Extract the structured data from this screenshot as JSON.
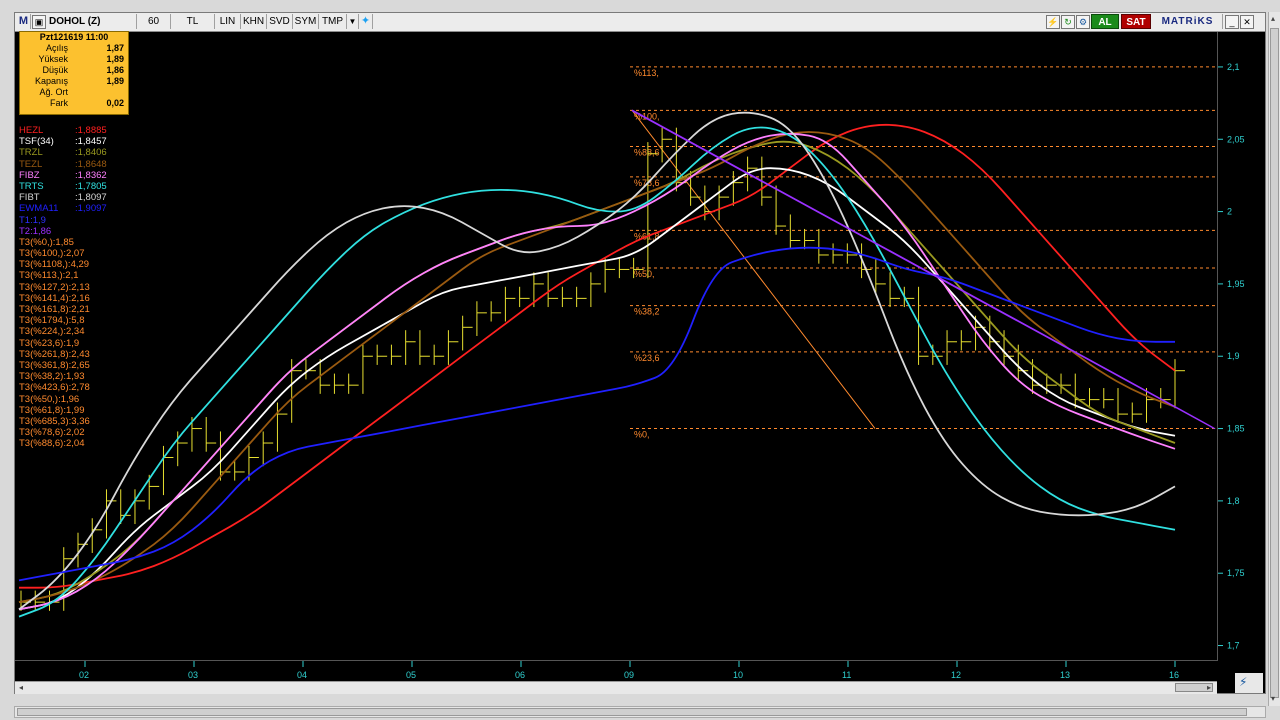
{
  "toolbar": {
    "logo": "M",
    "symbol": "DOHOL (Z)",
    "period": "60",
    "currency": "TL",
    "buttons": [
      "LIN",
      "KHN",
      "SVD",
      "SYM",
      "TMP"
    ],
    "buy_label": "AL",
    "sell_label": "SAT",
    "brand": "MATRiKS"
  },
  "info_box": {
    "title": "Pzt121619 11:00",
    "rows": [
      {
        "label": "Açılış",
        "value": "1,87"
      },
      {
        "label": "Yüksek",
        "value": "1,89"
      },
      {
        "label": "Düşük",
        "value": "1,86"
      },
      {
        "label": "Kapanış",
        "value": "1,89"
      },
      {
        "label": "Ağ. Ort",
        "value": ""
      },
      {
        "label": "Fark",
        "value": "0,02"
      }
    ]
  },
  "legend": [
    {
      "name": "HEZL",
      "value": ":1,8885",
      "color": "#ff2020"
    },
    {
      "name": "TSF(34)",
      "value": ":1,8457",
      "color": "#ffffff"
    },
    {
      "name": "TRZL",
      "value": ":1,8406",
      "color": "#9a9a20"
    },
    {
      "name": "TEZL",
      "value": ":1,8648",
      "color": "#9a5a10"
    },
    {
      "name": "FIBZ",
      "value": ":1,8362",
      "color": "#ff80ff"
    },
    {
      "name": "TRTS",
      "value": ":1,7805",
      "color": "#30e0e0"
    },
    {
      "name": "FIBT",
      "value": ":1,8097",
      "color": "#d8d8d8"
    },
    {
      "name": "EWMA11",
      "value": ":1,9097",
      "color": "#2020ff"
    },
    {
      "name": "T1:1,9",
      "value": "",
      "color": "#3030ff"
    },
    {
      "name": "T2:1,86",
      "value": "",
      "color": "#9a30ff"
    }
  ],
  "t3_levels": [
    "T3(%0,):1,85",
    "T3(%100,):2,07",
    "T3(%1108,):4,29",
    "T3(%113,):2,1",
    "T3(%127,2):2,13",
    "T3(%141,4):2,16",
    "T3(%161,8):2,21",
    "T3(%1794,):5,8",
    "T3(%224,):2,34",
    "T3(%23,6):1,9",
    "T3(%261,8):2,43",
    "T3(%361,8):2,65",
    "T3(%38,2):1,93",
    "T3(%423,6):2,78",
    "T3(%50,):1,96",
    "T3(%61,8):1,99",
    "T3(%685,3):3,36",
    "T3(%78,6):2,02",
    "T3(%88,6):2,04"
  ],
  "chart_data": {
    "type": "line",
    "ylim": [
      1.69,
      2.12
    ],
    "y_ticks": [
      "2,1",
      "2,05",
      "2",
      "1,95",
      "1,9",
      "1,85",
      "1,8",
      "1,75",
      "1,7"
    ],
    "y_values": [
      2.1,
      2.05,
      2.0,
      1.95,
      1.9,
      1.85,
      1.8,
      1.75,
      1.7
    ],
    "x_labels": [
      "02",
      "03",
      "04",
      "05",
      "06",
      "09",
      "10",
      "11",
      "12",
      "13",
      "16"
    ],
    "fib_levels": [
      {
        "label": "%113,",
        "value": 2.1
      },
      {
        "label": "%100,",
        "value": 2.07
      },
      {
        "label": "%88,6",
        "value": 2.045
      },
      {
        "label": "%78,6",
        "value": 2.024
      },
      {
        "label": "%61,8",
        "value": 1.987
      },
      {
        "label": "%50,",
        "value": 1.961
      },
      {
        "label": "%38,2",
        "value": 1.935
      },
      {
        "label": "%23,6",
        "value": 1.903
      },
      {
        "label": "%0,",
        "value": 1.85
      }
    ],
    "fib_color": "#ff8a2e",
    "price_color": "#e8e030",
    "price_close": [
      1.73,
      1.73,
      1.73,
      1.76,
      1.77,
      1.78,
      1.8,
      1.79,
      1.8,
      1.81,
      1.83,
      1.84,
      1.85,
      1.84,
      1.82,
      1.82,
      1.83,
      1.84,
      1.86,
      1.89,
      1.89,
      1.88,
      1.88,
      1.88,
      1.9,
      1.9,
      1.9,
      1.91,
      1.9,
      1.9,
      1.91,
      1.92,
      1.93,
      1.93,
      1.94,
      1.94,
      1.95,
      1.94,
      1.94,
      1.94,
      1.95,
      1.96,
      1.96,
      1.96,
      2.04,
      2.05,
      2.02,
      2.01,
      2.0,
      2.01,
      2.02,
      2.03,
      2.01,
      1.99,
      1.98,
      1.98,
      1.97,
      1.97,
      1.97,
      1.96,
      1.95,
      1.94,
      1.94,
      1.9,
      1.9,
      1.91,
      1.91,
      1.92,
      1.91,
      1.9,
      1.89,
      1.88,
      1.88,
      1.88,
      1.87,
      1.87,
      1.87,
      1.86,
      1.86,
      1.87,
      1.87,
      1.89
    ],
    "series": [
      {
        "name": "HEZL",
        "color": "#ff2020",
        "values": [
          1.74,
          1.74,
          1.745,
          1.75,
          1.76,
          1.775,
          1.79,
          1.81,
          1.83,
          1.85,
          1.87,
          1.89,
          1.91,
          1.93,
          1.95,
          1.965,
          1.98,
          1.99,
          2.0,
          2.01,
          2.03,
          2.05,
          2.06,
          2.06,
          2.05,
          2.03,
          2.0,
          1.97,
          1.94,
          1.91,
          1.89
        ]
      },
      {
        "name": "TSF(34)",
        "color": "#ffffff",
        "values": [
          1.725,
          1.73,
          1.75,
          1.78,
          1.8,
          1.82,
          1.85,
          1.88,
          1.9,
          1.915,
          1.93,
          1.945,
          1.95,
          1.955,
          1.96,
          1.965,
          1.97,
          1.99,
          2.01,
          2.03,
          2.03,
          2.02,
          2.0,
          1.98,
          1.95,
          1.92,
          1.89,
          1.87,
          1.86,
          1.85,
          1.845
        ]
      },
      {
        "name": "TRZL",
        "color": "#9a9a20",
        "values": [
          1.73,
          1.735,
          1.75,
          1.77,
          1.8,
          1.83,
          1.86,
          1.89,
          1.91,
          1.93,
          1.95,
          1.965,
          1.975,
          1.985,
          1.99,
          2.0,
          2.01,
          2.02,
          2.035,
          2.045,
          2.05,
          2.04,
          2.02,
          1.99,
          1.96,
          1.93,
          1.9,
          1.88,
          1.86,
          1.85,
          1.84
        ]
      },
      {
        "name": "TEZL",
        "color": "#9a5a10",
        "values": [
          1.73,
          1.735,
          1.745,
          1.76,
          1.78,
          1.81,
          1.84,
          1.87,
          1.89,
          1.91,
          1.93,
          1.95,
          1.97,
          1.98,
          1.99,
          2.0,
          2.01,
          2.02,
          2.03,
          2.045,
          2.055,
          2.055,
          2.045,
          2.02,
          1.99,
          1.96,
          1.93,
          1.91,
          1.89,
          1.875,
          1.865
        ]
      },
      {
        "name": "FIBZ",
        "color": "#ff80ff",
        "values": [
          1.725,
          1.73,
          1.745,
          1.77,
          1.8,
          1.83,
          1.86,
          1.89,
          1.91,
          1.93,
          1.95,
          1.965,
          1.975,
          1.985,
          1.99,
          1.99,
          2.0,
          2.015,
          2.035,
          2.05,
          2.055,
          2.05,
          2.02,
          1.99,
          1.95,
          1.91,
          1.88,
          1.865,
          1.855,
          1.845,
          1.836
        ]
      },
      {
        "name": "TRTS",
        "color": "#30e0e0",
        "values": [
          1.72,
          1.73,
          1.76,
          1.8,
          1.84,
          1.87,
          1.9,
          1.93,
          1.96,
          1.985,
          2.0,
          2.01,
          2.015,
          2.015,
          2.01,
          2.0,
          2.0,
          2.02,
          2.045,
          2.06,
          2.055,
          2.03,
          1.99,
          1.94,
          1.89,
          1.85,
          1.82,
          1.8,
          1.79,
          1.785,
          1.78
        ]
      },
      {
        "name": "FIBT",
        "color": "#d8d8d8",
        "values": [
          1.725,
          1.745,
          1.78,
          1.83,
          1.87,
          1.9,
          1.93,
          1.96,
          1.985,
          2.0,
          2.005,
          2.0,
          1.985,
          1.97,
          1.975,
          1.99,
          2.01,
          2.04,
          2.065,
          2.07,
          2.06,
          2.02,
          1.96,
          1.89,
          1.84,
          1.81,
          1.795,
          1.79,
          1.79,
          1.795,
          1.81
        ]
      },
      {
        "name": "EWMA11",
        "color": "#2020ff",
        "values": [
          1.745,
          1.75,
          1.755,
          1.76,
          1.77,
          1.79,
          1.82,
          1.835,
          1.84,
          1.845,
          1.85,
          1.855,
          1.86,
          1.865,
          1.87,
          1.875,
          1.88,
          1.89,
          1.96,
          1.97,
          1.975,
          1.975,
          1.97,
          1.96,
          1.955,
          1.945,
          1.935,
          1.925,
          1.915,
          1.91,
          1.91
        ]
      },
      {
        "name": "T2:1,86",
        "color": "#9a30ff",
        "values": [
          2.07,
          1.85
        ]
      }
    ]
  }
}
